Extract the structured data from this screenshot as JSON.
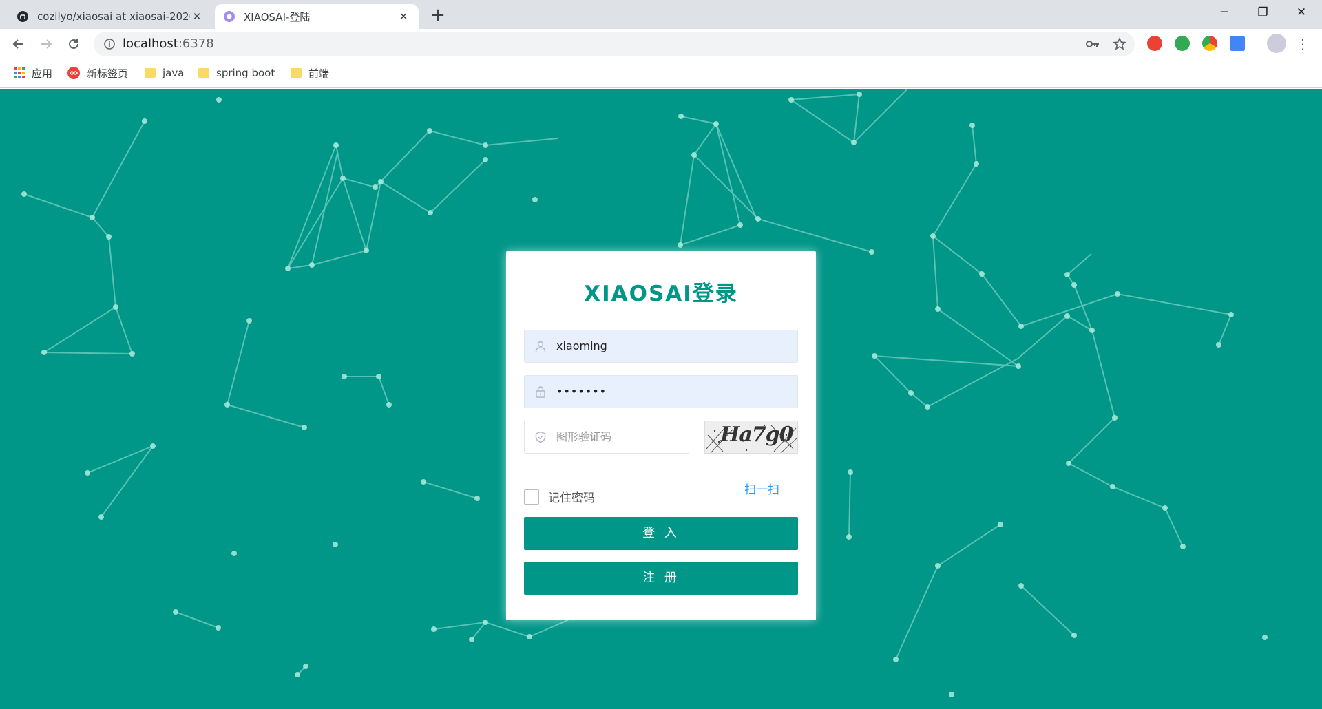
{
  "browser": {
    "tabs": [
      {
        "title": "cozilyo/xiaosai at xiaosai-2020",
        "icon": "github-icon"
      },
      {
        "title": "XIAOSAI-登陆",
        "icon": "app-favicon"
      }
    ],
    "url_host": "localhost",
    "url_port": ":6378",
    "bookmarks": [
      "应用",
      "新标签页",
      "java",
      "spring boot",
      "前端"
    ]
  },
  "login": {
    "title": "XIAOSAI登录",
    "username": "xiaoming",
    "password_masked": "•••••••",
    "captcha_placeholder": "图形验证码",
    "captcha_text": "Ha7g0",
    "remember_label": "记住密码",
    "scan_label": "扫一扫",
    "login_button": "登 入",
    "register_button": "注 册"
  },
  "colors": {
    "theme": "#009688",
    "link": "#1e9fff"
  }
}
